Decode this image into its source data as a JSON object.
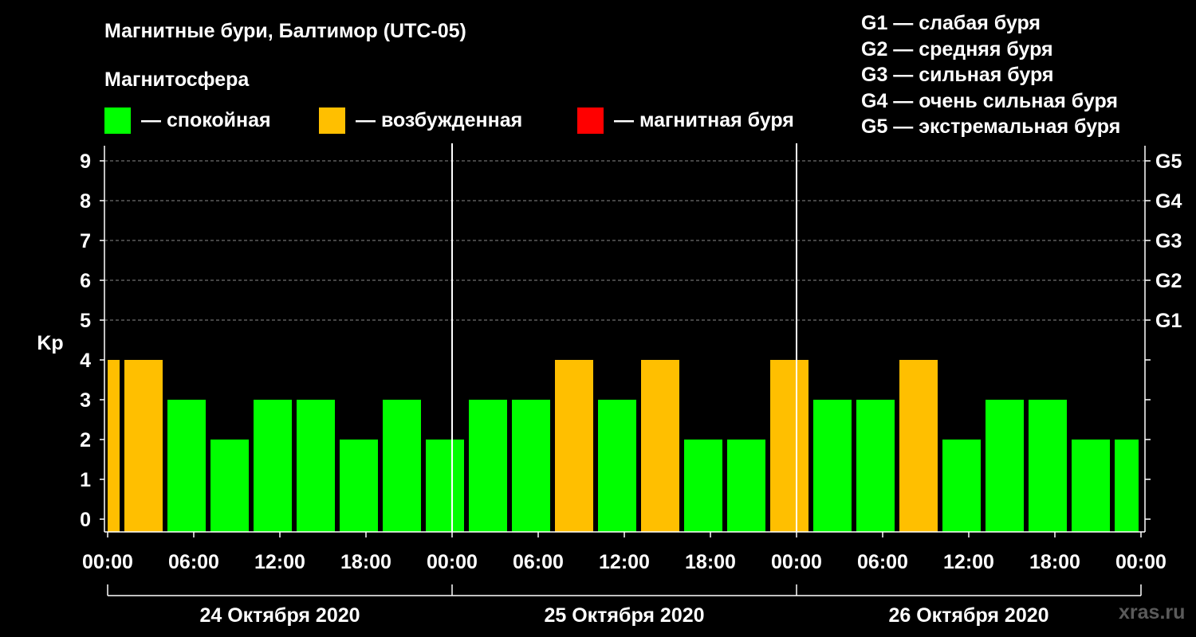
{
  "title": "Магнитные бури, Балтимор (UTC-05)",
  "subtitle": "Магнитосфера",
  "legend": [
    {
      "label": "— спокойная",
      "color": "#00ff00"
    },
    {
      "label": "— возбужденная",
      "color": "#ffbf00"
    },
    {
      "label": "— магнитная буря",
      "color": "#ff0000"
    }
  ],
  "storm_levels": [
    "G1 — слабая буря",
    "G2 — средняя буря",
    "G3 — сильная буря",
    "G4 — очень сильная буря",
    "G5 — экстремальная буря"
  ],
  "watermark": "xras.ru",
  "chart_data": {
    "type": "bar",
    "ylabel": "Kp",
    "ylim": [
      0,
      9
    ],
    "yticks": [
      "0",
      "1",
      "2",
      "3",
      "4",
      "5",
      "6",
      "7",
      "8",
      "9"
    ],
    "right_ticks": [
      {
        "kp": 5,
        "label": "G1"
      },
      {
        "kp": 6,
        "label": "G2"
      },
      {
        "kp": 7,
        "label": "G3"
      },
      {
        "kp": 8,
        "label": "G4"
      },
      {
        "kp": 9,
        "label": "G5"
      }
    ],
    "xticks": [
      "00:00",
      "06:00",
      "12:00",
      "18:00",
      "00:00",
      "06:00",
      "12:00",
      "18:00",
      "00:00",
      "06:00",
      "12:00",
      "18:00",
      "00:00"
    ],
    "days": [
      "24 Октября 2020",
      "25 Октября 2020",
      "26 Октября 2020"
    ],
    "grid": "horizontal dashed at G levels",
    "bars": [
      {
        "start": "24 Oct 00:00",
        "end": "24 Oct 01:00",
        "kp": 4,
        "state": "возбужденная"
      },
      {
        "start": "24 Oct 01:00",
        "end": "24 Oct 04:00",
        "kp": 4,
        "state": "возбужденная"
      },
      {
        "start": "24 Oct 04:00",
        "end": "24 Oct 07:00",
        "kp": 3,
        "state": "спокойная"
      },
      {
        "start": "24 Oct 07:00",
        "end": "24 Oct 10:00",
        "kp": 2,
        "state": "спокойная"
      },
      {
        "start": "24 Oct 10:00",
        "end": "24 Oct 13:00",
        "kp": 3,
        "state": "спокойная"
      },
      {
        "start": "24 Oct 13:00",
        "end": "24 Oct 16:00",
        "kp": 3,
        "state": "спокойная"
      },
      {
        "start": "24 Oct 16:00",
        "end": "24 Oct 19:00",
        "kp": 2,
        "state": "спокойная"
      },
      {
        "start": "24 Oct 19:00",
        "end": "24 Oct 22:00",
        "kp": 3,
        "state": "спокойная"
      },
      {
        "start": "24 Oct 22:00",
        "end": "25 Oct 01:00",
        "kp": 2,
        "state": "спокойная"
      },
      {
        "start": "25 Oct 01:00",
        "end": "25 Oct 04:00",
        "kp": 3,
        "state": "спокойная"
      },
      {
        "start": "25 Oct 04:00",
        "end": "25 Oct 07:00",
        "kp": 3,
        "state": "спокойная"
      },
      {
        "start": "25 Oct 07:00",
        "end": "25 Oct 10:00",
        "kp": 4,
        "state": "возбужденная"
      },
      {
        "start": "25 Oct 10:00",
        "end": "25 Oct 13:00",
        "kp": 3,
        "state": "спокойная"
      },
      {
        "start": "25 Oct 13:00",
        "end": "25 Oct 16:00",
        "kp": 4,
        "state": "возбужденная"
      },
      {
        "start": "25 Oct 16:00",
        "end": "25 Oct 19:00",
        "kp": 2,
        "state": "спокойная"
      },
      {
        "start": "25 Oct 19:00",
        "end": "25 Oct 22:00",
        "kp": 2,
        "state": "спокойная"
      },
      {
        "start": "25 Oct 22:00",
        "end": "26 Oct 01:00",
        "kp": 4,
        "state": "возбужденная"
      },
      {
        "start": "26 Oct 01:00",
        "end": "26 Oct 04:00",
        "kp": 3,
        "state": "спокойная"
      },
      {
        "start": "26 Oct 04:00",
        "end": "26 Oct 07:00",
        "kp": 3,
        "state": "спокойная"
      },
      {
        "start": "26 Oct 07:00",
        "end": "26 Oct 10:00",
        "kp": 4,
        "state": "возбужденная"
      },
      {
        "start": "26 Oct 10:00",
        "end": "26 Oct 13:00",
        "kp": 2,
        "state": "спокойная"
      },
      {
        "start": "26 Oct 13:00",
        "end": "26 Oct 16:00",
        "kp": 3,
        "state": "спокойная"
      },
      {
        "start": "26 Oct 16:00",
        "end": "26 Oct 19:00",
        "kp": 3,
        "state": "спокойная"
      },
      {
        "start": "26 Oct 19:00",
        "end": "26 Oct 22:00",
        "kp": 2,
        "state": "спокойная"
      },
      {
        "start": "26 Oct 22:00",
        "end": "27 Oct 00:00",
        "kp": 2,
        "state": "спокойная"
      }
    ]
  }
}
